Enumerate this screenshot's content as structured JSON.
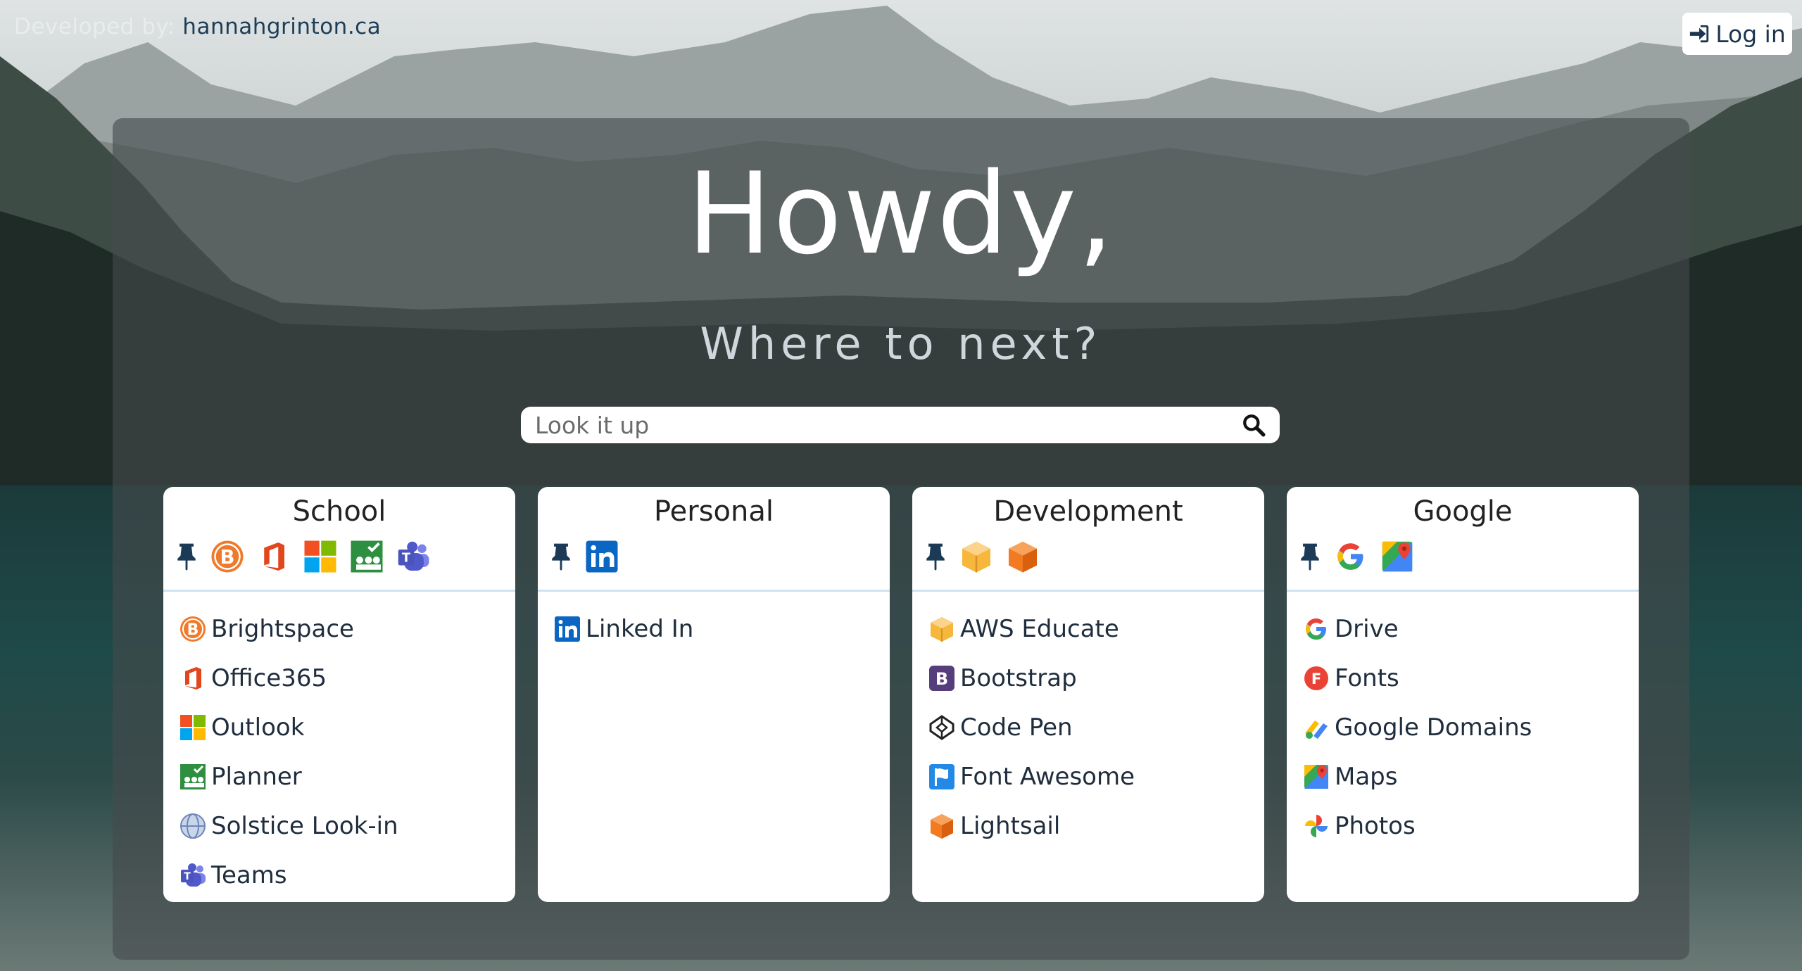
{
  "header": {
    "credit_prefix": "Developed by:",
    "credit_link": "hannahgrinton.ca",
    "login_label": "Log in"
  },
  "hero": {
    "greeting": "Howdy,",
    "subtitle": "Where to next?",
    "search_placeholder": "Look it up"
  },
  "cards": [
    {
      "title": "School",
      "pinned_icons": [
        "brightspace-icon",
        "office365-icon",
        "outlook-icon",
        "planner-icon",
        "teams-icon"
      ],
      "links": [
        {
          "label": "Brightspace",
          "icon": "brightspace-icon"
        },
        {
          "label": "Office365",
          "icon": "office365-icon"
        },
        {
          "label": "Outlook",
          "icon": "outlook-icon"
        },
        {
          "label": "Planner",
          "icon": "planner-icon"
        },
        {
          "label": "Solstice Look-in",
          "icon": "globe-icon"
        },
        {
          "label": "Teams",
          "icon": "teams-icon"
        }
      ]
    },
    {
      "title": "Personal",
      "pinned_icons": [
        "linkedin-icon"
      ],
      "links": [
        {
          "label": "Linked In",
          "icon": "linkedin-icon"
        }
      ]
    },
    {
      "title": "Development",
      "pinned_icons": [
        "aws-educate-icon",
        "lightsail-icon"
      ],
      "links": [
        {
          "label": "AWS Educate",
          "icon": "aws-educate-icon"
        },
        {
          "label": "Bootstrap",
          "icon": "bootstrap-icon"
        },
        {
          "label": "Code Pen",
          "icon": "codepen-icon"
        },
        {
          "label": "Font Awesome",
          "icon": "font-awesome-icon"
        },
        {
          "label": "Lightsail",
          "icon": "lightsail-icon"
        }
      ]
    },
    {
      "title": "Google",
      "pinned_icons": [
        "google-icon",
        "google-maps-icon"
      ],
      "links": [
        {
          "label": "Drive",
          "icon": "google-icon"
        },
        {
          "label": "Fonts",
          "icon": "google-fonts-icon"
        },
        {
          "label": "Google Domains",
          "icon": "google-domains-icon"
        },
        {
          "label": "Maps",
          "icon": "google-maps-icon"
        },
        {
          "label": "Photos",
          "icon": "google-photos-icon"
        }
      ]
    }
  ],
  "colors": {
    "panel": "#464a4c",
    "link_text": "#1f2d3d",
    "divider": "#cfe2f1",
    "credit_link": "#1c3e58"
  }
}
